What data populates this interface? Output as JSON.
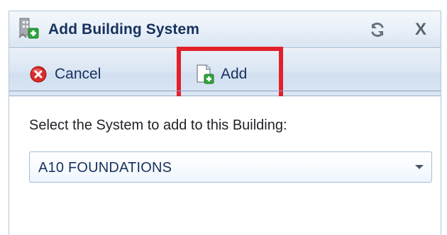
{
  "dialog": {
    "title": "Add Building System",
    "icons": {
      "title": "building-system-icon",
      "refresh": "refresh-icon",
      "close": "close-icon",
      "cancel": "cancel-icon",
      "add": "add-document-icon",
      "dropdown": "chevron-down-icon"
    },
    "close_glyph": "X"
  },
  "toolbar": {
    "cancel_label": "Cancel",
    "add_label": "Add"
  },
  "form": {
    "prompt": "Select the System to add to this Building:",
    "system_select": {
      "selected": "A10 FOUNDATIONS"
    }
  },
  "colors": {
    "title_text": "#17315d",
    "highlight": "#e3202a",
    "cancel_red": "#d92c2c",
    "add_green": "#35a33b"
  }
}
